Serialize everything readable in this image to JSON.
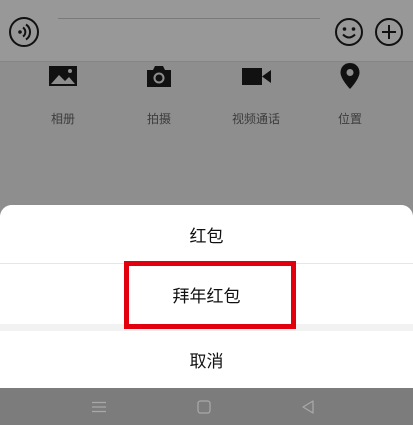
{
  "chat_input": {
    "voice_icon": "voice-wave-icon",
    "emoji_icon": "smiley-icon",
    "more_icon": "plus-circle-icon"
  },
  "features": [
    {
      "label": "相册",
      "icon": "image-icon"
    },
    {
      "label": "拍摄",
      "icon": "camera-icon"
    },
    {
      "label": "视频通话",
      "icon": "video-camera-icon"
    },
    {
      "label": "位置",
      "icon": "location-pin-icon"
    }
  ],
  "action_sheet": {
    "options": [
      "红包",
      "拜年红包"
    ],
    "cancel_label": "取消",
    "highlight_color": "#e2000f"
  },
  "system_nav": {
    "menu_icon": "menu-icon",
    "home_icon": "home-square-icon",
    "back_icon": "back-triangle-icon"
  }
}
